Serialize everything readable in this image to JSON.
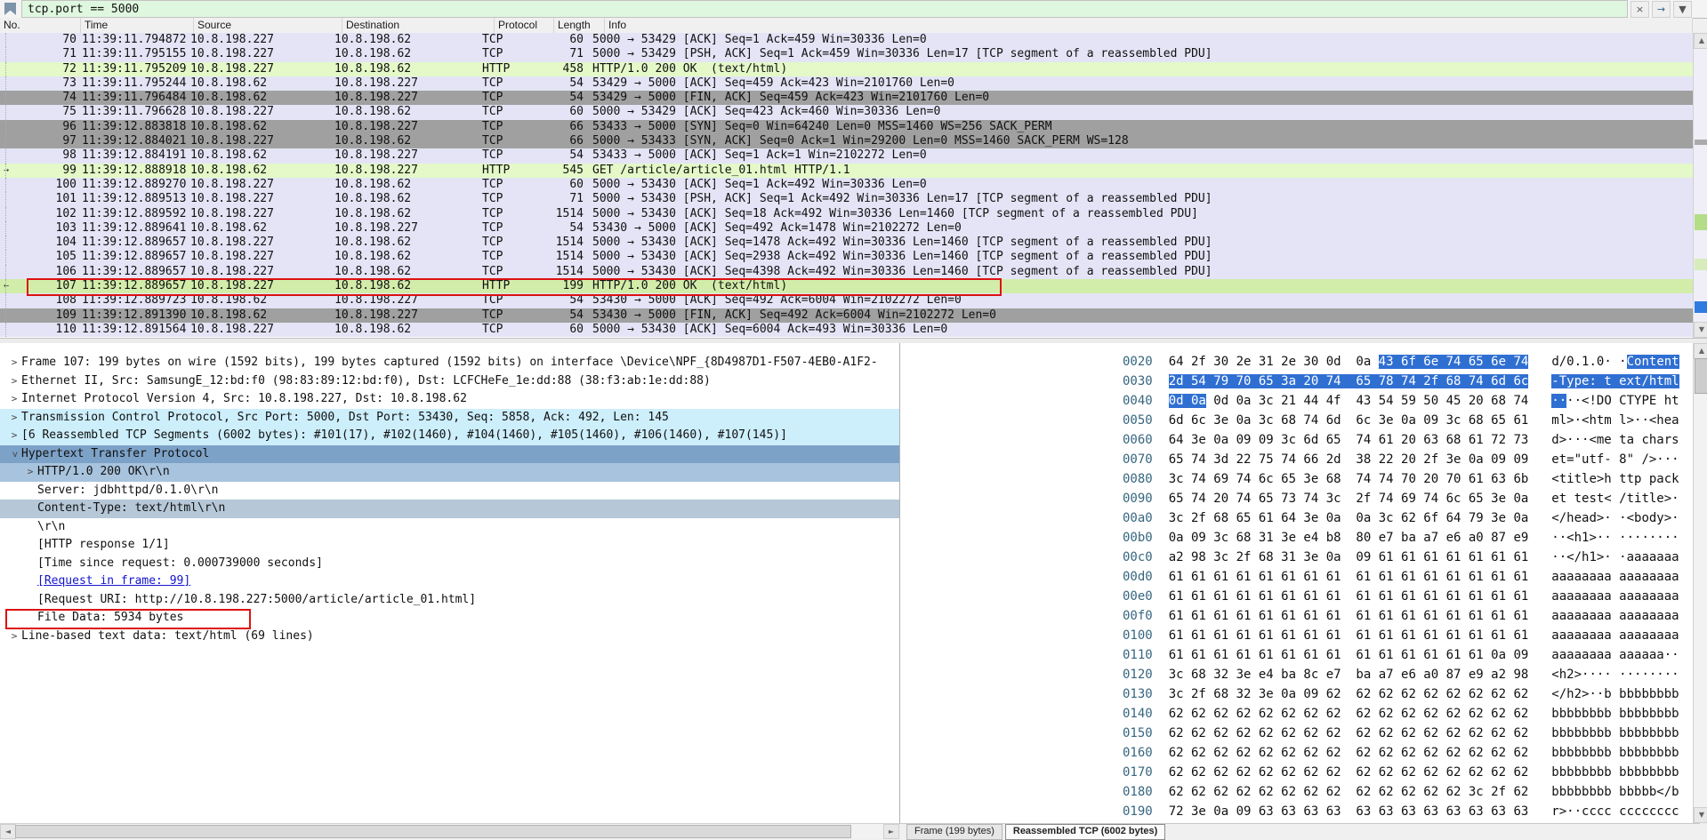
{
  "filter_bar": {
    "filter_text": "tcp.port == 5000",
    "clear_icon": "×",
    "apply_icon": "→",
    "dropdown_icon": "▼"
  },
  "packet_list": {
    "columns": [
      "No.",
      "Time",
      "Source",
      "Destination",
      "Protocol",
      "Length",
      "Info"
    ],
    "rows": [
      {
        "no": "70",
        "time": "11:39:11.794872",
        "src": "10.8.198.227",
        "dst": "10.8.198.62",
        "proto": "TCP",
        "len": "60",
        "info": "5000 → 53429 [ACK] Seq=1 Ack=459 Win=30336 Len=0",
        "style": "tcp",
        "marker": ""
      },
      {
        "no": "71",
        "time": "11:39:11.795155",
        "src": "10.8.198.227",
        "dst": "10.8.198.62",
        "proto": "TCP",
        "len": "71",
        "info": "5000 → 53429 [PSH, ACK] Seq=1 Ack=459 Win=30336 Len=17 [TCP segment of a reassembled PDU]",
        "style": "tcp",
        "marker": ""
      },
      {
        "no": "72",
        "time": "11:39:11.795209",
        "src": "10.8.198.227",
        "dst": "10.8.198.62",
        "proto": "HTTP",
        "len": "458",
        "info": "HTTP/1.0 200 OK  (text/html)",
        "style": "http",
        "marker": ""
      },
      {
        "no": "73",
        "time": "11:39:11.795244",
        "src": "10.8.198.62",
        "dst": "10.8.198.227",
        "proto": "TCP",
        "len": "54",
        "info": "53429 → 5000 [ACK] Seq=459 Ack=423 Win=2101760 Len=0",
        "style": "tcp",
        "marker": ""
      },
      {
        "no": "74",
        "time": "11:39:11.796484",
        "src": "10.8.198.62",
        "dst": "10.8.198.227",
        "proto": "TCP",
        "len": "54",
        "info": "53429 → 5000 [FIN, ACK] Seq=459 Ack=423 Win=2101760 Len=0",
        "style": "gray",
        "marker": ""
      },
      {
        "no": "75",
        "time": "11:39:11.796628",
        "src": "10.8.198.227",
        "dst": "10.8.198.62",
        "proto": "TCP",
        "len": "60",
        "info": "5000 → 53429 [ACK] Seq=423 Ack=460 Win=30336 Len=0",
        "style": "tcp",
        "marker": ""
      },
      {
        "no": "96",
        "time": "11:39:12.883818",
        "src": "10.8.198.62",
        "dst": "10.8.198.227",
        "proto": "TCP",
        "len": "66",
        "info": "53433 → 5000 [SYN] Seq=0 Win=64240 Len=0 MSS=1460 WS=256 SACK_PERM",
        "style": "gray",
        "marker": ""
      },
      {
        "no": "97",
        "time": "11:39:12.884021",
        "src": "10.8.198.227",
        "dst": "10.8.198.62",
        "proto": "TCP",
        "len": "66",
        "info": "5000 → 53433 [SYN, ACK] Seq=0 Ack=1 Win=29200 Len=0 MSS=1460 SACK_PERM WS=128",
        "style": "gray",
        "marker": ""
      },
      {
        "no": "98",
        "time": "11:39:12.884191",
        "src": "10.8.198.62",
        "dst": "10.8.198.227",
        "proto": "TCP",
        "len": "54",
        "info": "53433 → 5000 [ACK] Seq=1 Ack=1 Win=2102272 Len=0",
        "style": "tcp",
        "marker": ""
      },
      {
        "no": "99",
        "time": "11:39:12.888918",
        "src": "10.8.198.62",
        "dst": "10.8.198.227",
        "proto": "HTTP",
        "len": "545",
        "info": "GET /article/article_01.html HTTP/1.1",
        "style": "http",
        "marker": "→"
      },
      {
        "no": "100",
        "time": "11:39:12.889270",
        "src": "10.8.198.227",
        "dst": "10.8.198.62",
        "proto": "TCP",
        "len": "60",
        "info": "5000 → 53430 [ACK] Seq=1 Ack=492 Win=30336 Len=0",
        "style": "tcp",
        "marker": ""
      },
      {
        "no": "101",
        "time": "11:39:12.889513",
        "src": "10.8.198.227",
        "dst": "10.8.198.62",
        "proto": "TCP",
        "len": "71",
        "info": "5000 → 53430 [PSH, ACK] Seq=1 Ack=492 Win=30336 Len=17 [TCP segment of a reassembled PDU]",
        "style": "tcp",
        "marker": ""
      },
      {
        "no": "102",
        "time": "11:39:12.889592",
        "src": "10.8.198.227",
        "dst": "10.8.198.62",
        "proto": "TCP",
        "len": "1514",
        "info": "5000 → 53430 [ACK] Seq=18 Ack=492 Win=30336 Len=1460 [TCP segment of a reassembled PDU]",
        "style": "tcp",
        "marker": ""
      },
      {
        "no": "103",
        "time": "11:39:12.889641",
        "src": "10.8.198.62",
        "dst": "10.8.198.227",
        "proto": "TCP",
        "len": "54",
        "info": "53430 → 5000 [ACK] Seq=492 Ack=1478 Win=2102272 Len=0",
        "style": "tcp",
        "marker": ""
      },
      {
        "no": "104",
        "time": "11:39:12.889657",
        "src": "10.8.198.227",
        "dst": "10.8.198.62",
        "proto": "TCP",
        "len": "1514",
        "info": "5000 → 53430 [ACK] Seq=1478 Ack=492 Win=30336 Len=1460 [TCP segment of a reassembled PDU]",
        "style": "tcp",
        "marker": ""
      },
      {
        "no": "105",
        "time": "11:39:12.889657",
        "src": "10.8.198.227",
        "dst": "10.8.198.62",
        "proto": "TCP",
        "len": "1514",
        "info": "5000 → 53430 [ACK] Seq=2938 Ack=492 Win=30336 Len=1460 [TCP segment of a reassembled PDU]",
        "style": "tcp",
        "marker": ""
      },
      {
        "no": "106",
        "time": "11:39:12.889657",
        "src": "10.8.198.227",
        "dst": "10.8.198.62",
        "proto": "TCP",
        "len": "1514",
        "info": "5000 → 53430 [ACK] Seq=4398 Ack=492 Win=30336 Len=1460 [TCP segment of a reassembled PDU]",
        "style": "tcp",
        "marker": ""
      },
      {
        "no": "107",
        "time": "11:39:12.889657",
        "src": "10.8.198.227",
        "dst": "10.8.198.62",
        "proto": "HTTP",
        "len": "199",
        "info": "HTTP/1.0 200 OK  (text/html)",
        "style": "selected",
        "marker": "←"
      },
      {
        "no": "108",
        "time": "11:39:12.889723",
        "src": "10.8.198.62",
        "dst": "10.8.198.227",
        "proto": "TCP",
        "len": "54",
        "info": "53430 → 5000 [ACK] Seq=492 Ack=6004 Win=2102272 Len=0",
        "style": "tcp",
        "marker": ""
      },
      {
        "no": "109",
        "time": "11:39:12.891390",
        "src": "10.8.198.62",
        "dst": "10.8.198.227",
        "proto": "TCP",
        "len": "54",
        "info": "53430 → 5000 [FIN, ACK] Seq=492 Ack=6004 Win=2102272 Len=0",
        "style": "gray",
        "marker": ""
      },
      {
        "no": "110",
        "time": "11:39:12.891564",
        "src": "10.8.198.227",
        "dst": "10.8.198.62",
        "proto": "TCP",
        "len": "60",
        "info": "5000 → 53430 [ACK] Seq=6004 Ack=493 Win=30336 Len=0",
        "style": "tcp",
        "marker": ""
      }
    ]
  },
  "details_pane": {
    "rows": [
      {
        "indent": 0,
        "expander": ">",
        "text": "Frame 107: 199 bytes on wire (1592 bits), 199 bytes captured (1592 bits) on interface \\Device\\NPF_{8D4987D1-F507-4EB0-A1F2-",
        "style": ""
      },
      {
        "indent": 0,
        "expander": ">",
        "text": "Ethernet II, Src: SamsungE_12:bd:f0 (98:83:89:12:bd:f0), Dst: LCFCHeFe_1e:dd:88 (38:f3:ab:1e:dd:88)",
        "style": ""
      },
      {
        "indent": 0,
        "expander": ">",
        "text": "Internet Protocol Version 4, Src: 10.8.198.227, Dst: 10.8.198.62",
        "style": ""
      },
      {
        "indent": 0,
        "expander": ">",
        "text": "Transmission Control Protocol, Src Port: 5000, Dst Port: 53430, Seq: 5858, Ack: 492, Len: 145",
        "style": "hl-cyan"
      },
      {
        "indent": 0,
        "expander": ">",
        "text": "[6 Reassembled TCP Segments (6002 bytes): #101(17), #102(1460), #104(1460), #105(1460), #106(1460), #107(145)]",
        "style": "hl-cyan"
      },
      {
        "indent": 0,
        "expander": "v",
        "text": "Hypertext Transfer Protocol",
        "style": "hl-selmain"
      },
      {
        "indent": 1,
        "expander": ">",
        "text": "HTTP/1.0 200 OK\\r\\n",
        "style": "hl-selsub"
      },
      {
        "indent": 1,
        "expander": "",
        "text": "Server: jdbhttpd/0.1.0\\r\\n",
        "style": ""
      },
      {
        "indent": 1,
        "expander": "",
        "text": "Content-Type: text/html\\r\\n",
        "style": "hl-selfield"
      },
      {
        "indent": 1,
        "expander": "",
        "text": "\\r\\n",
        "style": ""
      },
      {
        "indent": 1,
        "expander": "",
        "text": "[HTTP response 1/1]",
        "style": ""
      },
      {
        "indent": 1,
        "expander": "",
        "text": "[Time since request: 0.000739000 seconds]",
        "style": ""
      },
      {
        "indent": 1,
        "expander": "",
        "text": "[Request in frame: 99]",
        "style": "link"
      },
      {
        "indent": 1,
        "expander": "",
        "text": "[Request URI: http://10.8.198.227:5000/article/article_01.html]",
        "style": ""
      },
      {
        "indent": 1,
        "expander": "",
        "text": "File Data: 5934 bytes",
        "style": "filedata"
      },
      {
        "indent": 0,
        "expander": ">",
        "text": "Line-based text data: text/html (69 lines)",
        "style": ""
      }
    ]
  },
  "bytes_pane": {
    "rows": [
      {
        "offset": "0020",
        "h1": "64 2f 30 2e 31 2e 30 0d  0a ",
        "hs": "43 6f 6e 74 65 6e 74",
        "h2": "",
        "a1": "d/0.1.0· ·",
        "as": "Content",
        "a2": ""
      },
      {
        "offset": "0030",
        "h1": "",
        "hs": "2d 54 79 70 65 3a 20 74  65 78 74 2f 68 74 6d 6c",
        "h2": "",
        "a1": "",
        "as": "-Type: t ext/html",
        "a2": ""
      },
      {
        "offset": "0040",
        "h1": "",
        "hs": "0d 0a",
        "h2": " 0d 0a 3c 21 44 4f  43 54 59 50 45 20 68 74",
        "a1": "",
        "as": "··",
        "a2": "··<!DO CTYPE ht"
      },
      {
        "offset": "0050",
        "h1": "6d 6c 3e 0a 3c 68 74 6d  6c 3e 0a 09 3c 68 65 61",
        "hs": "",
        "h2": "",
        "a1": "ml>·<htm l>··<hea",
        "as": "",
        "a2": ""
      },
      {
        "offset": "0060",
        "h1": "64 3e 0a 09 09 3c 6d 65  74 61 20 63 68 61 72 73",
        "hs": "",
        "h2": "",
        "a1": "d>···<me ta chars",
        "as": "",
        "a2": ""
      },
      {
        "offset": "0070",
        "h1": "65 74 3d 22 75 74 66 2d  38 22 20 2f 3e 0a 09 09",
        "hs": "",
        "h2": "",
        "a1": "et=\"utf- 8\" />···",
        "as": "",
        "a2": ""
      },
      {
        "offset": "0080",
        "h1": "3c 74 69 74 6c 65 3e 68  74 74 70 20 70 61 63 6b",
        "hs": "",
        "h2": "",
        "a1": "<title>h ttp pack",
        "as": "",
        "a2": ""
      },
      {
        "offset": "0090",
        "h1": "65 74 20 74 65 73 74 3c  2f 74 69 74 6c 65 3e 0a",
        "hs": "",
        "h2": "",
        "a1": "et test< /title>·",
        "as": "",
        "a2": ""
      },
      {
        "offset": "00a0",
        "h1": "3c 2f 68 65 61 64 3e 0a  0a 3c 62 6f 64 79 3e 0a",
        "hs": "",
        "h2": "",
        "a1": "</head>· ·<body>·",
        "as": "",
        "a2": ""
      },
      {
        "offset": "00b0",
        "h1": "0a 09 3c 68 31 3e e4 b8  80 e7 ba a7 e6 a0 87 e9",
        "hs": "",
        "h2": "",
        "a1": "··<h1>·· ········",
        "as": "",
        "a2": ""
      },
      {
        "offset": "00c0",
        "h1": "a2 98 3c 2f 68 31 3e 0a  09 61 61 61 61 61 61 61",
        "hs": "",
        "h2": "",
        "a1": "··</h1>· ·aaaaaaa",
        "as": "",
        "a2": ""
      },
      {
        "offset": "00d0",
        "h1": "61 61 61 61 61 61 61 61  61 61 61 61 61 61 61 61",
        "hs": "",
        "h2": "",
        "a1": "aaaaaaaa aaaaaaaa",
        "as": "",
        "a2": ""
      },
      {
        "offset": "00e0",
        "h1": "61 61 61 61 61 61 61 61  61 61 61 61 61 61 61 61",
        "hs": "",
        "h2": "",
        "a1": "aaaaaaaa aaaaaaaa",
        "as": "",
        "a2": ""
      },
      {
        "offset": "00f0",
        "h1": "61 61 61 61 61 61 61 61  61 61 61 61 61 61 61 61",
        "hs": "",
        "h2": "",
        "a1": "aaaaaaaa aaaaaaaa",
        "as": "",
        "a2": ""
      },
      {
        "offset": "0100",
        "h1": "61 61 61 61 61 61 61 61  61 61 61 61 61 61 61 61",
        "hs": "",
        "h2": "",
        "a1": "aaaaaaaa aaaaaaaa",
        "as": "",
        "a2": ""
      },
      {
        "offset": "0110",
        "h1": "61 61 61 61 61 61 61 61  61 61 61 61 61 61 0a 09",
        "hs": "",
        "h2": "",
        "a1": "aaaaaaaa aaaaaa··",
        "as": "",
        "a2": ""
      },
      {
        "offset": "0120",
        "h1": "3c 68 32 3e e4 ba 8c e7  ba a7 e6 a0 87 e9 a2 98",
        "hs": "",
        "h2": "",
        "a1": "<h2>···· ········",
        "as": "",
        "a2": ""
      },
      {
        "offset": "0130",
        "h1": "3c 2f 68 32 3e 0a 09 62  62 62 62 62 62 62 62 62",
        "hs": "",
        "h2": "",
        "a1": "</h2>··b bbbbbbbb",
        "as": "",
        "a2": ""
      },
      {
        "offset": "0140",
        "h1": "62 62 62 62 62 62 62 62  62 62 62 62 62 62 62 62",
        "hs": "",
        "h2": "",
        "a1": "bbbbbbbb bbbbbbbb",
        "as": "",
        "a2": ""
      },
      {
        "offset": "0150",
        "h1": "62 62 62 62 62 62 62 62  62 62 62 62 62 62 62 62",
        "hs": "",
        "h2": "",
        "a1": "bbbbbbbb bbbbbbbb",
        "as": "",
        "a2": ""
      },
      {
        "offset": "0160",
        "h1": "62 62 62 62 62 62 62 62  62 62 62 62 62 62 62 62",
        "hs": "",
        "h2": "",
        "a1": "bbbbbbbb bbbbbbbb",
        "as": "",
        "a2": ""
      },
      {
        "offset": "0170",
        "h1": "62 62 62 62 62 62 62 62  62 62 62 62 62 62 62 62",
        "hs": "",
        "h2": "",
        "a1": "bbbbbbbb bbbbbbbb",
        "as": "",
        "a2": ""
      },
      {
        "offset": "0180",
        "h1": "62 62 62 62 62 62 62 62  62 62 62 62 62 3c 2f 62",
        "hs": "",
        "h2": "",
        "a1": "bbbbbbbb bbbbb</b",
        "as": "",
        "a2": ""
      },
      {
        "offset": "0190",
        "h1": "72 3e 0a 09 63 63 63 63  63 63 63 63 63 63 63 63",
        "hs": "",
        "h2": "",
        "a1": "r>··cccc cccccccc",
        "as": "",
        "a2": ""
      }
    ],
    "tabs": [
      {
        "label": "Frame (199 bytes)",
        "active": false
      },
      {
        "label": "Reassembled TCP (6002 bytes)",
        "active": true
      }
    ]
  }
}
